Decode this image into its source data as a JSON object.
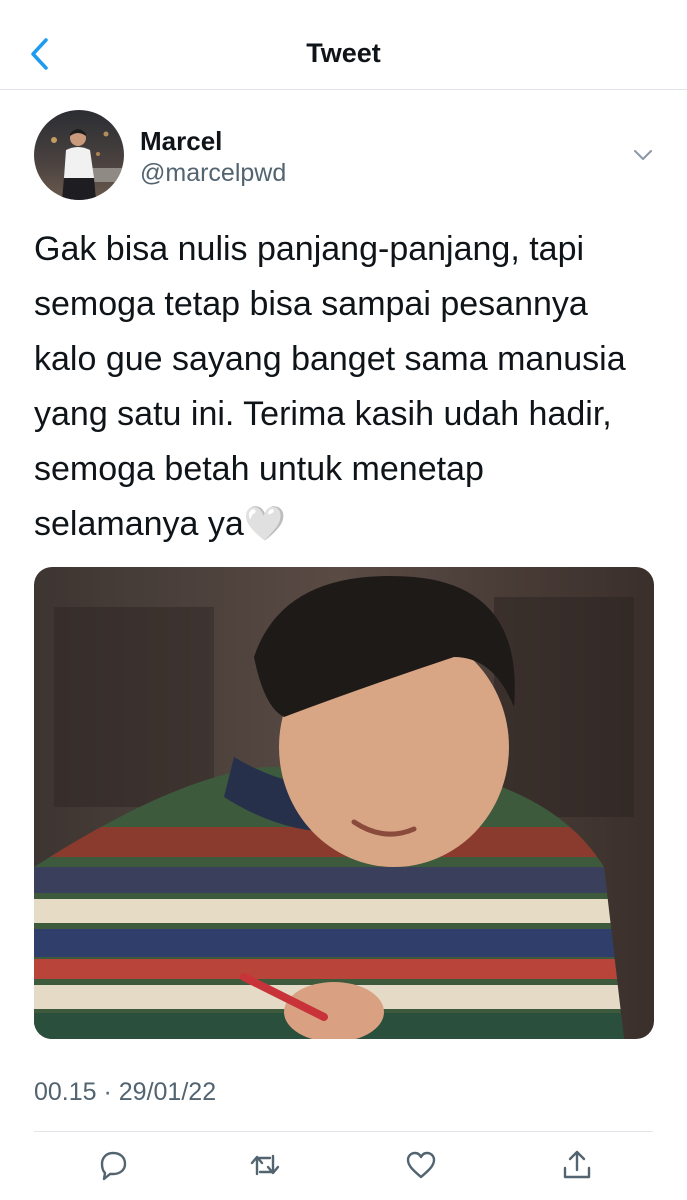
{
  "nav": {
    "back_icon": "chevron-left-icon",
    "title": "Tweet",
    "accent_color": "#1d9bf0"
  },
  "tweet": {
    "author": {
      "display_name": "Marcel",
      "handle": "@marcelpwd"
    },
    "text": "Gak bisa nulis panjang-panjang, tapi semoga tetap bisa sampai pesannya kalo gue sayang banget sama manusia yang satu ini. Terima kasih udah hadir, semoga betah untuk menetap selamanya ya🤍",
    "timestamp": "00.15 · 29/01/22"
  },
  "actions": [
    {
      "name": "reply",
      "icon": "reply-icon"
    },
    {
      "name": "retweet",
      "icon": "retweet-icon"
    },
    {
      "name": "like",
      "icon": "heart-icon"
    },
    {
      "name": "share",
      "icon": "share-icon"
    }
  ]
}
